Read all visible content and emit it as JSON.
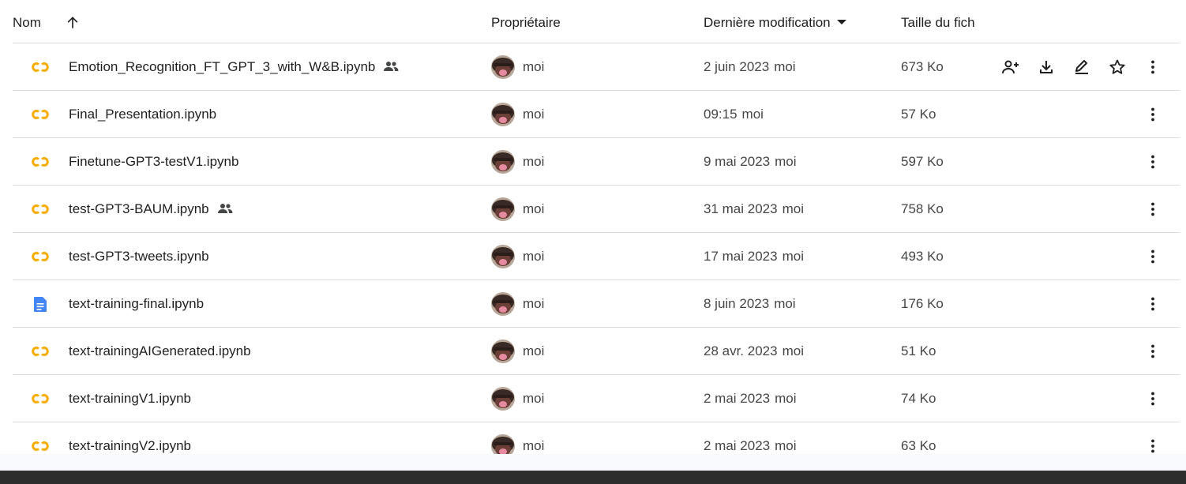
{
  "header": {
    "name_label": "Nom",
    "sort_icon": "arrow-up-icon",
    "owner_label": "Propriétaire",
    "modified_label": "Dernière modification",
    "size_label": "Taille du fich"
  },
  "files": [
    {
      "name": "Emotion_Recognition_FT_GPT_3_with_W&B.ipynb",
      "type": "colab",
      "shared": true,
      "owner": "moi",
      "modified_date": "2 juin 2023",
      "modified_by": "moi",
      "size": "673 Ko"
    },
    {
      "name": "Final_Presentation.ipynb",
      "type": "colab",
      "shared": false,
      "owner": "moi",
      "modified_date": "09:15",
      "modified_by": "moi",
      "size": "57 Ko"
    },
    {
      "name": "Finetune-GPT3-testV1.ipynb",
      "type": "colab",
      "shared": false,
      "owner": "moi",
      "modified_date": "9 mai 2023",
      "modified_by": "moi",
      "size": "597 Ko"
    },
    {
      "name": "test-GPT3-BAUM.ipynb",
      "type": "colab",
      "shared": true,
      "owner": "moi",
      "modified_date": "31 mai 2023",
      "modified_by": "moi",
      "size": "758 Ko"
    },
    {
      "name": "test-GPT3-tweets.ipynb",
      "type": "colab",
      "shared": false,
      "owner": "moi",
      "modified_date": "17 mai 2023",
      "modified_by": "moi",
      "size": "493 Ko"
    },
    {
      "name": "text-training-final.ipynb",
      "type": "doc",
      "shared": false,
      "owner": "moi",
      "modified_date": "8 juin 2023",
      "modified_by": "moi",
      "size": "176 Ko"
    },
    {
      "name": "text-trainingAIGenerated.ipynb",
      "type": "colab",
      "shared": false,
      "owner": "moi",
      "modified_date": "28 avr. 2023",
      "modified_by": "moi",
      "size": "51 Ko"
    },
    {
      "name": "text-trainingV1.ipynb",
      "type": "colab",
      "shared": false,
      "owner": "moi",
      "modified_date": "2 mai 2023",
      "modified_by": "moi",
      "size": "74 Ko"
    },
    {
      "name": "text-trainingV2.ipynb",
      "type": "colab",
      "shared": false,
      "owner": "moi",
      "modified_date": "2 mai 2023",
      "modified_by": "moi",
      "size": "63 Ko"
    }
  ],
  "hover_row_actions": [
    "share-icon",
    "download-icon",
    "rename-icon",
    "star-icon"
  ],
  "colors": {
    "colab": "#f9ab00",
    "doc": "#4285f4",
    "text": "#1f1f1f",
    "muted": "#444746",
    "divider": "#dadce0"
  }
}
